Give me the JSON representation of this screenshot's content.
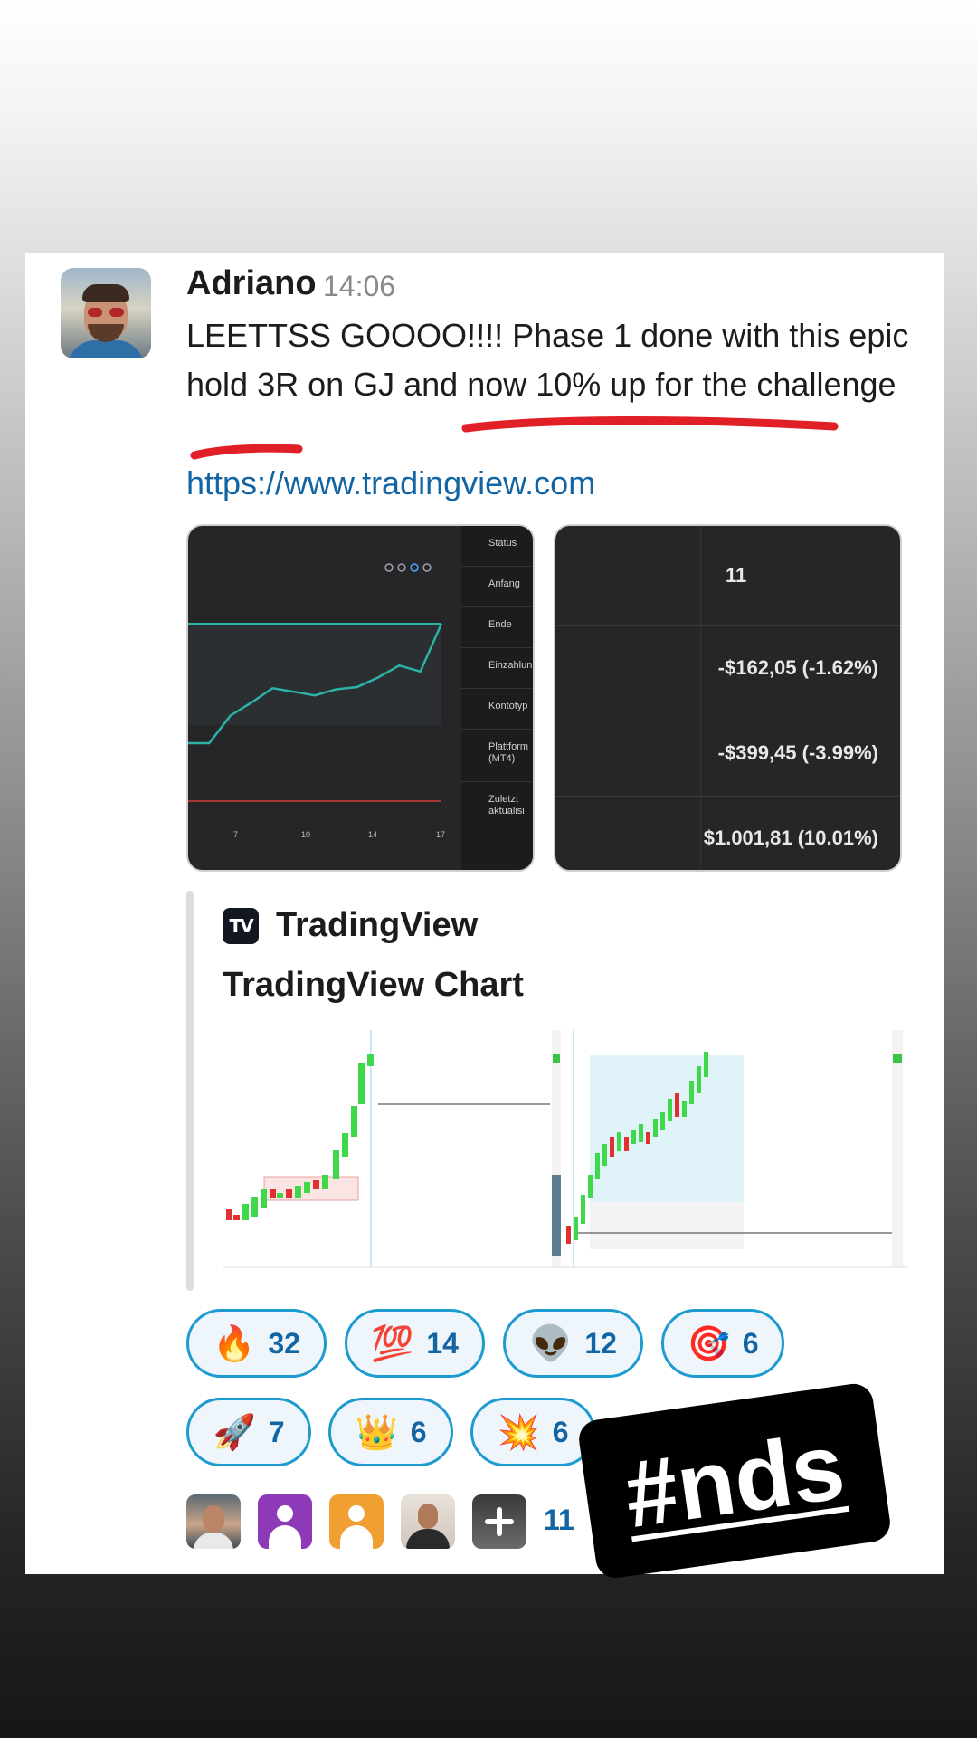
{
  "message": {
    "author": "Adriano",
    "time": "14:06",
    "text": "LEETTSS GOOOO!!!! Phase 1 done with this epic hold 3R on GJ and now 10% up for the challenge",
    "link": "https://www.tradingview.com"
  },
  "thumbnail_left": {
    "sidebar_labels": [
      "Status",
      "Anfang",
      "Ende",
      "Einzahlun",
      "Kontotyp",
      "Plattform (MT4)",
      "Zuletzt aktualisi"
    ],
    "x_ticks": [
      "7",
      "10",
      "14",
      "17"
    ],
    "chart_data": {
      "type": "line",
      "x": [
        1,
        2,
        3,
        4,
        5,
        6,
        7,
        8,
        9,
        10,
        11,
        12,
        13
      ],
      "values": [
        0.0,
        0.0,
        2.3,
        3.4,
        4.6,
        4.3,
        4.0,
        4.5,
        4.7,
        5.5,
        6.5,
        6.0,
        10.0
      ],
      "series_color": "#2ab3a6",
      "target_color": "#2ab3a6",
      "drawdown_color": "#d43c3c"
    }
  },
  "thumbnail_right": {
    "rows": [
      "11",
      "-$162,05 (-1.62%)",
      "-$399,45 (-3.99%)",
      "$1.001,81 (10.01%)"
    ]
  },
  "embed": {
    "provider": "TradingView",
    "logo": "TV",
    "title": "TradingView Chart"
  },
  "reactions": [
    {
      "emoji": "🔥",
      "icon": "fire-icon",
      "count": "32"
    },
    {
      "emoji": "💯",
      "icon": "hundred-icon",
      "count": "14"
    },
    {
      "emoji": "👽",
      "icon": "alien-icon",
      "count": "12"
    },
    {
      "emoji": "🎯",
      "icon": "target-icon",
      "count": "6"
    },
    {
      "emoji": "🚀",
      "icon": "rocket-icon",
      "count": "7"
    },
    {
      "emoji": "👑",
      "icon": "crown-icon",
      "count": "6"
    },
    {
      "emoji": "💥",
      "icon": "collision-icon",
      "count": "6"
    }
  ],
  "viewers": {
    "count": "11"
  },
  "sticker": {
    "text": "#nds"
  },
  "colors": {
    "link": "#1264a3",
    "reaction_border": "#1d9bd1",
    "scribble": "#e01f26"
  }
}
